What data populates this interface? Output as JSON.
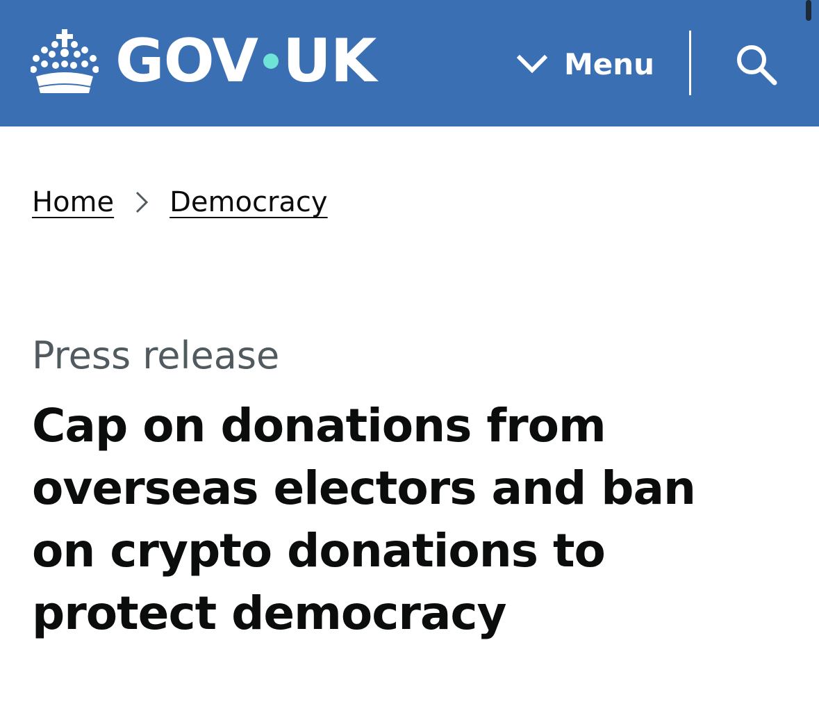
{
  "header": {
    "logo_text_left": "GOV",
    "logo_text_right": "UK",
    "logo_dot_color": "#6ee4d6",
    "background_color": "#3b6fb4",
    "menu_label": "Menu",
    "menu_icon": "chevron-down-icon",
    "search_icon": "search-icon",
    "crown_icon": "crown-icon"
  },
  "breadcrumb": {
    "items": [
      {
        "label": "Home"
      },
      {
        "label": "Democracy"
      }
    ],
    "separator_icon": "chevron-right-icon"
  },
  "article": {
    "type_caption": "Press release",
    "title": "Cap on donations from overseas electors and ban on crypto donations to protect democracy"
  }
}
